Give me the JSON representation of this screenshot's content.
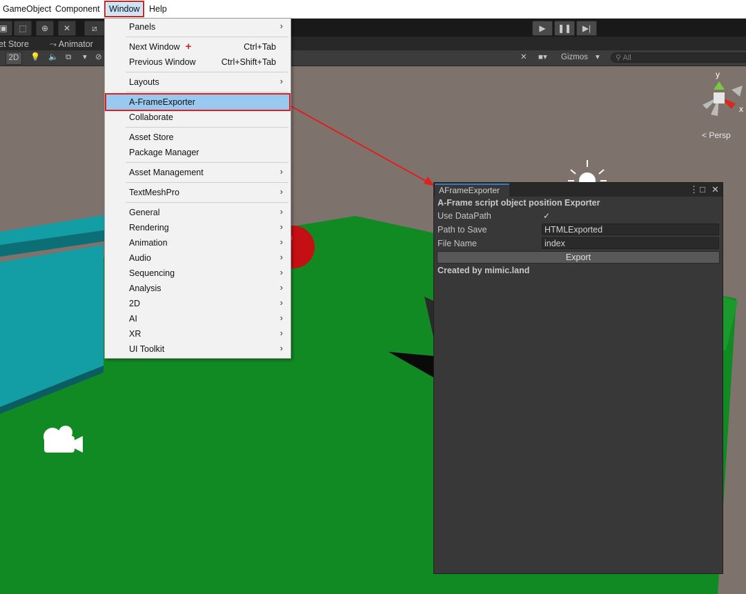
{
  "menubar": {
    "items": [
      "GameObject",
      "Component",
      "Window",
      "Help"
    ]
  },
  "scene": {
    "tabs": [
      "et Store",
      "Animator"
    ],
    "mode_2d": "2D",
    "gizmos": "Gizmos",
    "search_placeholder": "All",
    "persp": "< Persp",
    "axis_y": "y",
    "axis_x": "x"
  },
  "window_menu": {
    "items": [
      {
        "label": "Panels",
        "submenu": true
      },
      {
        "label": "Next Window",
        "shortcut": "Ctrl+Tab"
      },
      {
        "label": "Previous Window",
        "shortcut": "Ctrl+Shift+Tab"
      },
      {
        "label": "Layouts",
        "submenu": true
      },
      {
        "label": "A-FrameExporter",
        "highlighted": true
      },
      {
        "label": "Collaborate"
      },
      {
        "label": "Asset Store"
      },
      {
        "label": "Package Manager"
      },
      {
        "label": "Asset Management",
        "submenu": true
      },
      {
        "label": "TextMeshPro",
        "submenu": true
      },
      {
        "label": "General",
        "submenu": true
      },
      {
        "label": "Rendering",
        "submenu": true
      },
      {
        "label": "Animation",
        "submenu": true
      },
      {
        "label": "Audio",
        "submenu": true
      },
      {
        "label": "Sequencing",
        "submenu": true
      },
      {
        "label": "Analysis",
        "submenu": true
      },
      {
        "label": "2D",
        "submenu": true
      },
      {
        "label": "AI",
        "submenu": true
      },
      {
        "label": "XR",
        "submenu": true
      },
      {
        "label": "UI Toolkit",
        "submenu": true
      }
    ],
    "annotation_plus": "+"
  },
  "exporter_panel": {
    "tab_title": "AFrameExporter",
    "heading": "A-Frame script object position Exporter",
    "use_datapath_label": "Use DataPath",
    "use_datapath_checked": true,
    "checkmark": "✓",
    "path_label": "Path to Save",
    "path_value": "HTMLExported",
    "filename_label": "File Name",
    "filename_value": "index",
    "export_button": "Export",
    "footer": "Created by mimic.land"
  },
  "colors": {
    "highlight_outline": "#e01f1f",
    "menu_highlight": "#99c9ef",
    "ground": "#128a24",
    "platform": "#139ea6",
    "sky": "#7d736c"
  }
}
